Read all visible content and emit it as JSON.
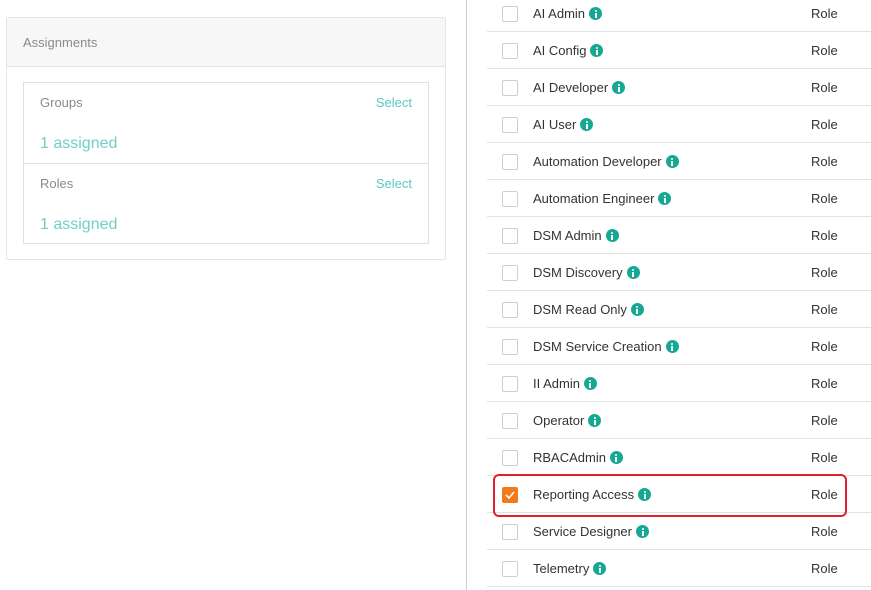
{
  "assignments": {
    "title": "Assignments",
    "groups": {
      "label": "Groups",
      "select": "Select",
      "value": "1 assigned"
    },
    "roles": {
      "label": "Roles",
      "select": "Select",
      "value": "1 assigned"
    }
  },
  "role_list": {
    "rows": [
      {
        "name": "AI Admin",
        "type": "Role",
        "checked": false
      },
      {
        "name": "AI Config",
        "type": "Role",
        "checked": false
      },
      {
        "name": "AI Developer",
        "type": "Role",
        "checked": false
      },
      {
        "name": "AI User",
        "type": "Role",
        "checked": false
      },
      {
        "name": "Automation Developer",
        "type": "Role",
        "checked": false
      },
      {
        "name": "Automation Engineer",
        "type": "Role",
        "checked": false
      },
      {
        "name": "DSM Admin",
        "type": "Role",
        "checked": false
      },
      {
        "name": "DSM Discovery",
        "type": "Role",
        "checked": false
      },
      {
        "name": "DSM Read Only",
        "type": "Role",
        "checked": false
      },
      {
        "name": "DSM Service Creation",
        "type": "Role",
        "checked": false
      },
      {
        "name": "II Admin",
        "type": "Role",
        "checked": false
      },
      {
        "name": "Operator",
        "type": "Role",
        "checked": false
      },
      {
        "name": "RBACAdmin",
        "type": "Role",
        "checked": false
      },
      {
        "name": "Reporting Access",
        "type": "Role",
        "checked": true
      },
      {
        "name": "Service Designer",
        "type": "Role",
        "checked": false
      },
      {
        "name": "Telemetry",
        "type": "Role",
        "checked": false
      }
    ]
  },
  "icons": {
    "info": "info-icon",
    "check": "checkmark-icon"
  },
  "colors": {
    "accent": "#5cc7c2",
    "checked": "#f27a1a",
    "info": "#17a894",
    "highlight": "#e0202a"
  }
}
